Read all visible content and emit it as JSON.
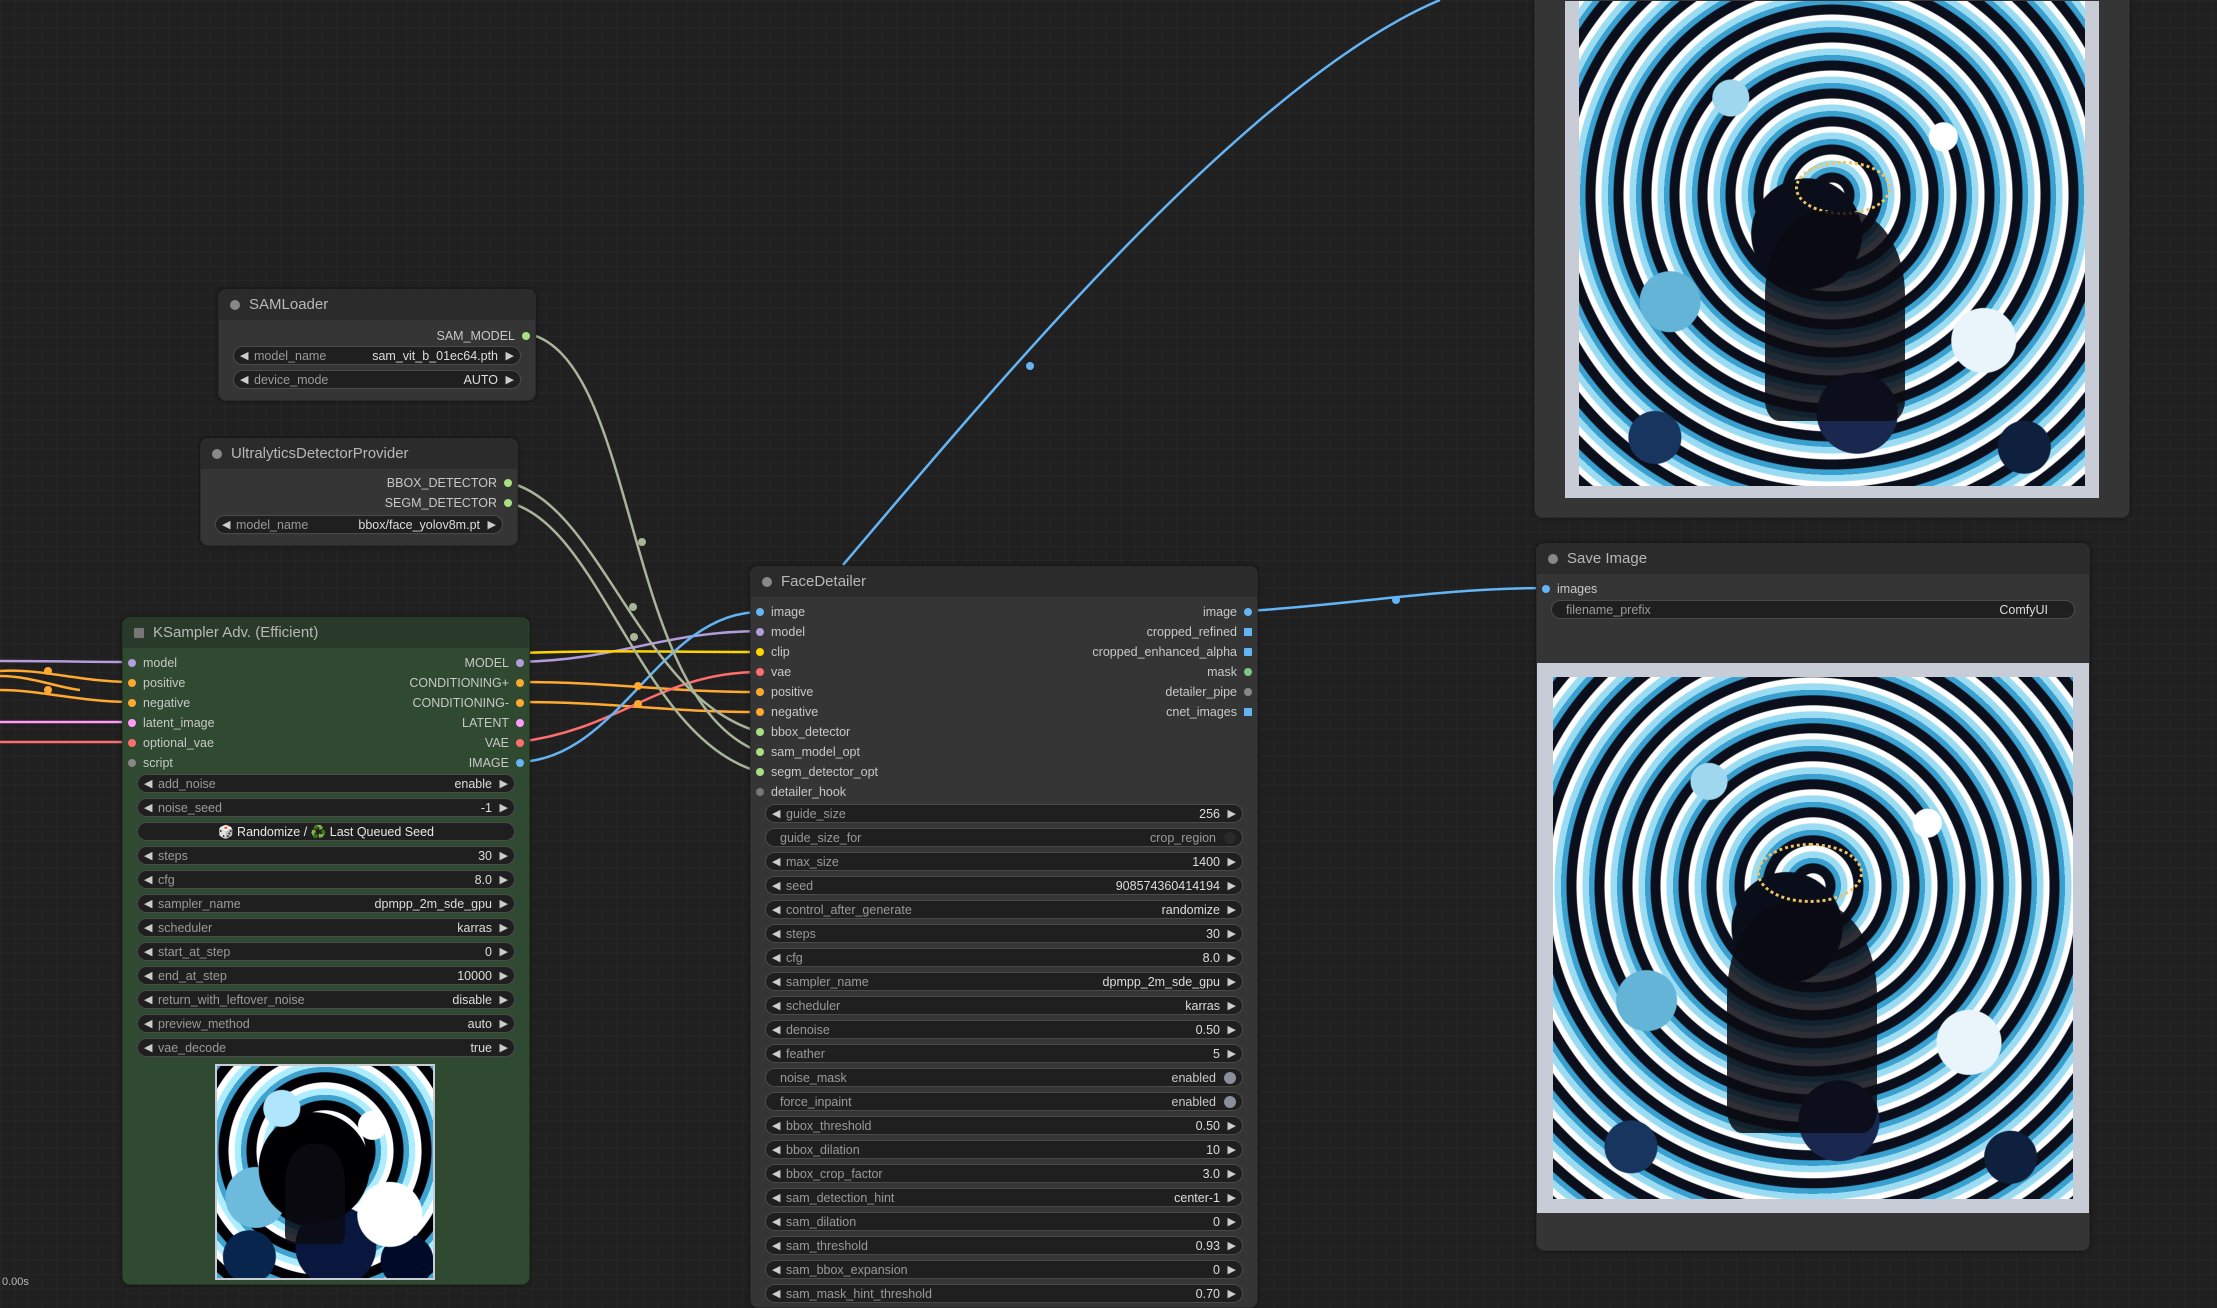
{
  "status": {
    "timer": "0.00s"
  },
  "colors": {
    "background": "#202020",
    "node_bg": "#353535",
    "ksampler_bg": "#2f4a30",
    "link_image": "#64b5f6",
    "link_gray": "#a9b59a",
    "link_model": "#b39ddb",
    "link_conditioning": "#ffa931",
    "link_latent": "#ff9cf9",
    "link_vae": "#ff6e6e"
  },
  "sam_loader": {
    "title": "SAMLoader",
    "output": "SAM_MODEL",
    "widgets": [
      {
        "label": "model_name",
        "value": "sam_vit_b_01ec64.pth"
      },
      {
        "label": "device_mode",
        "value": "AUTO"
      }
    ]
  },
  "ultralytics": {
    "title": "UltralyticsDetectorProvider",
    "outputs": [
      "BBOX_DETECTOR",
      "SEGM_DETECTOR"
    ],
    "widgets": [
      {
        "label": "model_name",
        "value": "bbox/face_yolov8m.pt"
      }
    ]
  },
  "ksampler": {
    "title": "KSampler Adv. (Efficient)",
    "inputs": [
      "model",
      "positive",
      "negative",
      "latent_image",
      "optional_vae",
      "script"
    ],
    "outputs": [
      "MODEL",
      "CONDITIONING+",
      "CONDITIONING-",
      "LATENT",
      "VAE",
      "IMAGE"
    ],
    "widgets": [
      {
        "label": "add_noise",
        "value": "enable"
      },
      {
        "label": "noise_seed",
        "value": "-1"
      },
      {
        "label": "steps",
        "value": "30"
      },
      {
        "label": "cfg",
        "value": "8.0"
      },
      {
        "label": "sampler_name",
        "value": "dpmpp_2m_sde_gpu"
      },
      {
        "label": "scheduler",
        "value": "karras"
      },
      {
        "label": "start_at_step",
        "value": "0"
      },
      {
        "label": "end_at_step",
        "value": "10000"
      },
      {
        "label": "return_with_leftover_noise",
        "value": "disable"
      },
      {
        "label": "preview_method",
        "value": "auto"
      },
      {
        "label": "vae_decode",
        "value": "true"
      }
    ],
    "button": {
      "left": "🎲 Randomize / ",
      "icon": "♻️",
      "right": " Last Queued Seed"
    }
  },
  "face_detailer": {
    "title": "FaceDetailer",
    "inputs": [
      "image",
      "model",
      "clip",
      "vae",
      "positive",
      "negative",
      "bbox_detector",
      "sam_model_opt",
      "segm_detector_opt",
      "detailer_hook"
    ],
    "outputs": [
      "image",
      "cropped_refined",
      "cropped_enhanced_alpha",
      "mask",
      "detailer_pipe",
      "cnet_images"
    ],
    "widgets": [
      {
        "label": "guide_size",
        "value": "256"
      },
      {
        "label": "guide_size_for",
        "value": "crop_region"
      },
      {
        "label": "max_size",
        "value": "1400"
      },
      {
        "label": "seed",
        "value": "908574360414194"
      },
      {
        "label": "control_after_generate",
        "value": "randomize"
      },
      {
        "label": "steps",
        "value": "30"
      },
      {
        "label": "cfg",
        "value": "8.0"
      },
      {
        "label": "sampler_name",
        "value": "dpmpp_2m_sde_gpu"
      },
      {
        "label": "scheduler",
        "value": "karras"
      },
      {
        "label": "denoise",
        "value": "0.50"
      },
      {
        "label": "feather",
        "value": "5"
      },
      {
        "label": "noise_mask",
        "value": "enabled"
      },
      {
        "label": "force_inpaint",
        "value": "enabled"
      },
      {
        "label": "bbox_threshold",
        "value": "0.50"
      },
      {
        "label": "bbox_dilation",
        "value": "10"
      },
      {
        "label": "bbox_crop_factor",
        "value": "3.0"
      },
      {
        "label": "sam_detection_hint",
        "value": "center-1"
      },
      {
        "label": "sam_dilation",
        "value": "0"
      },
      {
        "label": "sam_threshold",
        "value": "0.93"
      },
      {
        "label": "sam_bbox_expansion",
        "value": "0"
      },
      {
        "label": "sam_mask_hint_threshold",
        "value": "0.70"
      }
    ]
  },
  "save_image": {
    "title": "Save Image",
    "input": "images",
    "widgets": [
      {
        "label": "filename_prefix",
        "value": "ComfyUI"
      }
    ]
  }
}
